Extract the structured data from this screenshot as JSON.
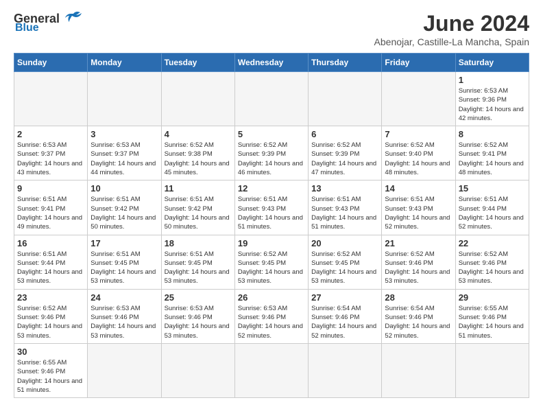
{
  "header": {
    "logo_general": "General",
    "logo_blue": "Blue",
    "month_title": "June 2024",
    "location": "Abenojar, Castille-La Mancha, Spain"
  },
  "weekdays": [
    "Sunday",
    "Monday",
    "Tuesday",
    "Wednesday",
    "Thursday",
    "Friday",
    "Saturday"
  ],
  "weeks": [
    [
      {
        "day": "",
        "sunrise": "",
        "sunset": "",
        "daylight": ""
      },
      {
        "day": "",
        "sunrise": "",
        "sunset": "",
        "daylight": ""
      },
      {
        "day": "",
        "sunrise": "",
        "sunset": "",
        "daylight": ""
      },
      {
        "day": "",
        "sunrise": "",
        "sunset": "",
        "daylight": ""
      },
      {
        "day": "",
        "sunrise": "",
        "sunset": "",
        "daylight": ""
      },
      {
        "day": "",
        "sunrise": "",
        "sunset": "",
        "daylight": ""
      },
      {
        "day": "1",
        "sunrise": "Sunrise: 6:53 AM",
        "sunset": "Sunset: 9:36 PM",
        "daylight": "Daylight: 14 hours and 42 minutes."
      }
    ],
    [
      {
        "day": "2",
        "sunrise": "Sunrise: 6:53 AM",
        "sunset": "Sunset: 9:37 PM",
        "daylight": "Daylight: 14 hours and 43 minutes."
      },
      {
        "day": "3",
        "sunrise": "Sunrise: 6:53 AM",
        "sunset": "Sunset: 9:37 PM",
        "daylight": "Daylight: 14 hours and 44 minutes."
      },
      {
        "day": "4",
        "sunrise": "Sunrise: 6:52 AM",
        "sunset": "Sunset: 9:38 PM",
        "daylight": "Daylight: 14 hours and 45 minutes."
      },
      {
        "day": "5",
        "sunrise": "Sunrise: 6:52 AM",
        "sunset": "Sunset: 9:39 PM",
        "daylight": "Daylight: 14 hours and 46 minutes."
      },
      {
        "day": "6",
        "sunrise": "Sunrise: 6:52 AM",
        "sunset": "Sunset: 9:39 PM",
        "daylight": "Daylight: 14 hours and 47 minutes."
      },
      {
        "day": "7",
        "sunrise": "Sunrise: 6:52 AM",
        "sunset": "Sunset: 9:40 PM",
        "daylight": "Daylight: 14 hours and 48 minutes."
      },
      {
        "day": "8",
        "sunrise": "Sunrise: 6:52 AM",
        "sunset": "Sunset: 9:41 PM",
        "daylight": "Daylight: 14 hours and 48 minutes."
      }
    ],
    [
      {
        "day": "9",
        "sunrise": "Sunrise: 6:51 AM",
        "sunset": "Sunset: 9:41 PM",
        "daylight": "Daylight: 14 hours and 49 minutes."
      },
      {
        "day": "10",
        "sunrise": "Sunrise: 6:51 AM",
        "sunset": "Sunset: 9:42 PM",
        "daylight": "Daylight: 14 hours and 50 minutes."
      },
      {
        "day": "11",
        "sunrise": "Sunrise: 6:51 AM",
        "sunset": "Sunset: 9:42 PM",
        "daylight": "Daylight: 14 hours and 50 minutes."
      },
      {
        "day": "12",
        "sunrise": "Sunrise: 6:51 AM",
        "sunset": "Sunset: 9:43 PM",
        "daylight": "Daylight: 14 hours and 51 minutes."
      },
      {
        "day": "13",
        "sunrise": "Sunrise: 6:51 AM",
        "sunset": "Sunset: 9:43 PM",
        "daylight": "Daylight: 14 hours and 51 minutes."
      },
      {
        "day": "14",
        "sunrise": "Sunrise: 6:51 AM",
        "sunset": "Sunset: 9:43 PM",
        "daylight": "Daylight: 14 hours and 52 minutes."
      },
      {
        "day": "15",
        "sunrise": "Sunrise: 6:51 AM",
        "sunset": "Sunset: 9:44 PM",
        "daylight": "Daylight: 14 hours and 52 minutes."
      }
    ],
    [
      {
        "day": "16",
        "sunrise": "Sunrise: 6:51 AM",
        "sunset": "Sunset: 9:44 PM",
        "daylight": "Daylight: 14 hours and 53 minutes."
      },
      {
        "day": "17",
        "sunrise": "Sunrise: 6:51 AM",
        "sunset": "Sunset: 9:45 PM",
        "daylight": "Daylight: 14 hours and 53 minutes."
      },
      {
        "day": "18",
        "sunrise": "Sunrise: 6:51 AM",
        "sunset": "Sunset: 9:45 PM",
        "daylight": "Daylight: 14 hours and 53 minutes."
      },
      {
        "day": "19",
        "sunrise": "Sunrise: 6:52 AM",
        "sunset": "Sunset: 9:45 PM",
        "daylight": "Daylight: 14 hours and 53 minutes."
      },
      {
        "day": "20",
        "sunrise": "Sunrise: 6:52 AM",
        "sunset": "Sunset: 9:45 PM",
        "daylight": "Daylight: 14 hours and 53 minutes."
      },
      {
        "day": "21",
        "sunrise": "Sunrise: 6:52 AM",
        "sunset": "Sunset: 9:46 PM",
        "daylight": "Daylight: 14 hours and 53 minutes."
      },
      {
        "day": "22",
        "sunrise": "Sunrise: 6:52 AM",
        "sunset": "Sunset: 9:46 PM",
        "daylight": "Daylight: 14 hours and 53 minutes."
      }
    ],
    [
      {
        "day": "23",
        "sunrise": "Sunrise: 6:52 AM",
        "sunset": "Sunset: 9:46 PM",
        "daylight": "Daylight: 14 hours and 53 minutes."
      },
      {
        "day": "24",
        "sunrise": "Sunrise: 6:53 AM",
        "sunset": "Sunset: 9:46 PM",
        "daylight": "Daylight: 14 hours and 53 minutes."
      },
      {
        "day": "25",
        "sunrise": "Sunrise: 6:53 AM",
        "sunset": "Sunset: 9:46 PM",
        "daylight": "Daylight: 14 hours and 53 minutes."
      },
      {
        "day": "26",
        "sunrise": "Sunrise: 6:53 AM",
        "sunset": "Sunset: 9:46 PM",
        "daylight": "Daylight: 14 hours and 52 minutes."
      },
      {
        "day": "27",
        "sunrise": "Sunrise: 6:54 AM",
        "sunset": "Sunset: 9:46 PM",
        "daylight": "Daylight: 14 hours and 52 minutes."
      },
      {
        "day": "28",
        "sunrise": "Sunrise: 6:54 AM",
        "sunset": "Sunset: 9:46 PM",
        "daylight": "Daylight: 14 hours and 52 minutes."
      },
      {
        "day": "29",
        "sunrise": "Sunrise: 6:55 AM",
        "sunset": "Sunset: 9:46 PM",
        "daylight": "Daylight: 14 hours and 51 minutes."
      }
    ],
    [
      {
        "day": "30",
        "sunrise": "Sunrise: 6:55 AM",
        "sunset": "Sunset: 9:46 PM",
        "daylight": "Daylight: 14 hours and 51 minutes."
      },
      {
        "day": "",
        "sunrise": "",
        "sunset": "",
        "daylight": ""
      },
      {
        "day": "",
        "sunrise": "",
        "sunset": "",
        "daylight": ""
      },
      {
        "day": "",
        "sunrise": "",
        "sunset": "",
        "daylight": ""
      },
      {
        "day": "",
        "sunrise": "",
        "sunset": "",
        "daylight": ""
      },
      {
        "day": "",
        "sunrise": "",
        "sunset": "",
        "daylight": ""
      },
      {
        "day": "",
        "sunrise": "",
        "sunset": "",
        "daylight": ""
      }
    ]
  ]
}
